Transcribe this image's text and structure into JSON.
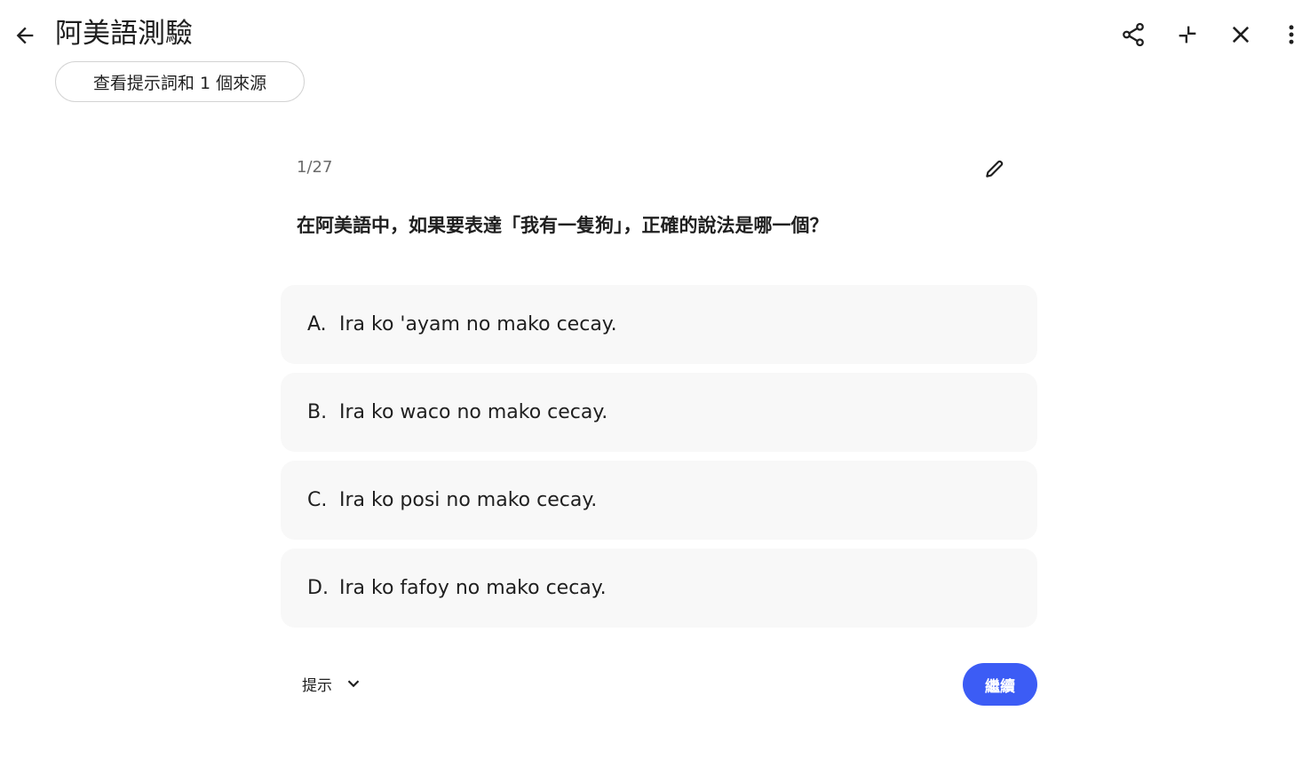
{
  "header": {
    "title": "阿美語測驗",
    "back_icon": "arrow-back-icon",
    "source_chip": "查看提示詞和 1 個來源",
    "actions": [
      {
        "name": "share-icon"
      },
      {
        "name": "collapse-icon"
      },
      {
        "name": "close-icon"
      },
      {
        "name": "more-vert-icon"
      }
    ]
  },
  "quiz": {
    "counter": "1/27",
    "edit_icon": "pencil-icon",
    "question": "在阿美語中，如果要表達「我有一隻狗」，正確的說法是哪一個？",
    "options": [
      {
        "letter": "A.",
        "text": "Ira ko 'ayam no mako cecay."
      },
      {
        "letter": "B.",
        "text": "Ira ko waco no mako cecay."
      },
      {
        "letter": "C.",
        "text": "Ira ko posi no mako cecay."
      },
      {
        "letter": "D.",
        "text": "Ira ko fafoy no mako cecay."
      }
    ],
    "hint_label": "提示",
    "continue_label": "繼續"
  },
  "colors": {
    "accent": "#3c5cf5",
    "option_bg": "#f8f8f8",
    "text": "#1f1f1f",
    "muted": "#6b6b6b"
  }
}
